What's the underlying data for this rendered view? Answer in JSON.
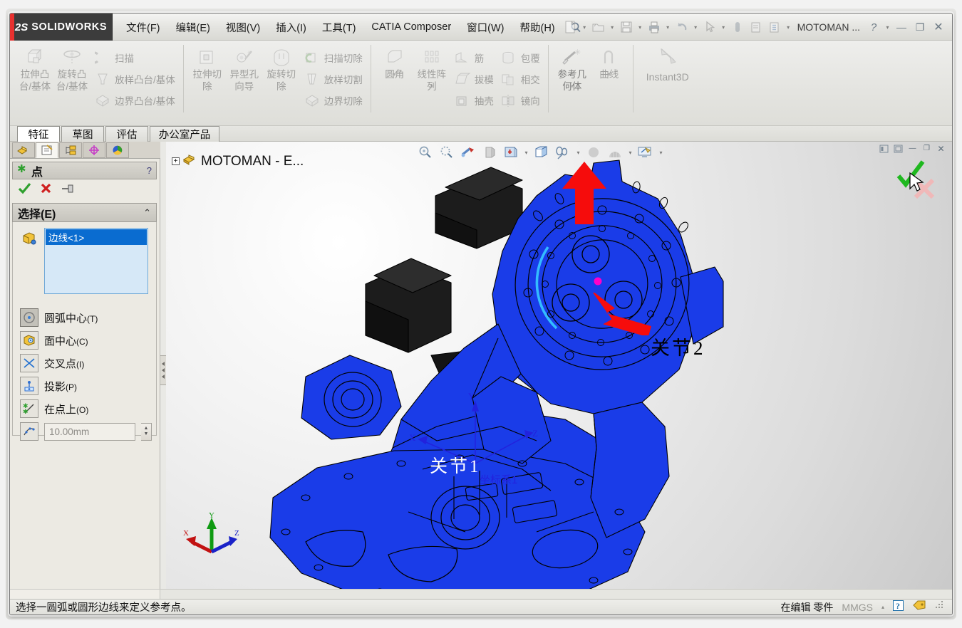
{
  "window": {
    "brand": "SOLIDWORKS",
    "brand_mark": "2S",
    "document_name": "MOTOMAN ...",
    "help_glyph": "?",
    "minimize_glyph": "—",
    "restore_glyph": "❐",
    "close_glyph": "✕"
  },
  "menus": [
    {
      "label": "文件(F)",
      "name": "menu-file"
    },
    {
      "label": "编辑(E)",
      "name": "menu-edit"
    },
    {
      "label": "视图(V)",
      "name": "menu-view"
    },
    {
      "label": "插入(I)",
      "name": "menu-insert"
    },
    {
      "label": "工具(T)",
      "name": "menu-tools"
    },
    {
      "label": "CATIA Composer",
      "name": "menu-catia-composer"
    },
    {
      "label": "窗口(W)",
      "name": "menu-window"
    },
    {
      "label": "帮助(H)",
      "name": "menu-help"
    }
  ],
  "quick_access": [
    {
      "icon": "new-document-icon",
      "has_caret": true
    },
    {
      "icon": "open-folder-icon",
      "has_caret": true
    },
    {
      "icon": "save-icon",
      "has_caret": true
    },
    {
      "icon": "print-icon",
      "has_caret": true
    },
    {
      "icon": "undo-icon",
      "has_caret": true
    },
    {
      "icon": "select-cursor-icon",
      "has_caret": true
    },
    {
      "icon": "rebuild-icon",
      "has_caret": false
    },
    {
      "icon": "file-properties-icon",
      "has_caret": false
    },
    {
      "icon": "options-icon",
      "has_caret": true
    }
  ],
  "ribbon": {
    "groups": [
      {
        "name": "boss-base-group",
        "big": [
          {
            "label": "拉伸凸台/基体",
            "icon": "extrude-boss-icon"
          },
          {
            "label": "旋转凸台/基体",
            "icon": "revolve-boss-icon"
          }
        ],
        "small": [
          {
            "label": "扫描",
            "icon": "sweep-icon"
          },
          {
            "label": "放样凸台/基体",
            "icon": "loft-boss-icon"
          },
          {
            "label": "边界凸台/基体",
            "icon": "boundary-boss-icon"
          }
        ]
      },
      {
        "name": "cut-group",
        "big": [
          {
            "label": "拉伸切除",
            "icon": "extrude-cut-icon"
          },
          {
            "label": "异型孔向导",
            "icon": "hole-wizard-icon"
          },
          {
            "label": "旋转切除",
            "icon": "revolve-cut-icon"
          }
        ],
        "small": [
          {
            "label": "扫描切除",
            "icon": "sweep-cut-icon"
          },
          {
            "label": "放样切割",
            "icon": "loft-cut-icon"
          },
          {
            "label": "边界切除",
            "icon": "boundary-cut-icon"
          }
        ]
      },
      {
        "name": "features-group",
        "big": [
          {
            "label": "圆角",
            "icon": "fillet-icon",
            "caret": true
          },
          {
            "label": "线性阵列",
            "icon": "linear-pattern-icon",
            "caret": true
          }
        ],
        "small": [
          {
            "label": "筋",
            "icon": "rib-icon"
          },
          {
            "label": "拔模",
            "icon": "draft-icon"
          },
          {
            "label": "抽壳",
            "icon": "shell-icon"
          }
        ],
        "small2": [
          {
            "label": "包覆",
            "icon": "wrap-icon"
          },
          {
            "label": "相交",
            "icon": "intersect-icon"
          },
          {
            "label": "镜向",
            "icon": "mirror-icon"
          }
        ]
      },
      {
        "name": "reference-group",
        "big": [
          {
            "label": "参考几何体",
            "icon": "reference-geometry-icon",
            "caret": true
          },
          {
            "label": "曲线",
            "icon": "curves-icon",
            "caret": true
          }
        ]
      }
    ],
    "instant3d": {
      "label": "Instant3D",
      "icon": "instant3d-icon"
    }
  },
  "command_tabs": [
    {
      "label": "特征",
      "active": true
    },
    {
      "label": "草图",
      "active": false
    },
    {
      "label": "评估",
      "active": false
    },
    {
      "label": "办公室产品",
      "active": false
    }
  ],
  "manager_tabs": [
    {
      "name": "feature-manager-tab",
      "icon": "feature-tree-icon",
      "active": false
    },
    {
      "name": "property-manager-tab",
      "icon": "property-manager-icon",
      "active": true
    },
    {
      "name": "configuration-manager-tab",
      "icon": "configuration-icon",
      "active": false
    },
    {
      "name": "dimxpert-manager-tab",
      "icon": "dimxpert-icon",
      "active": false
    },
    {
      "name": "display-manager-tab",
      "icon": "appearance-sphere-icon",
      "active": false
    }
  ],
  "property_manager": {
    "title": "点",
    "title_icon": "point-asterisk-icon",
    "help_glyph": "?",
    "actions": [
      {
        "name": "ok-button",
        "icon": "green-check-icon"
      },
      {
        "name": "cancel-button",
        "icon": "red-x-icon"
      },
      {
        "name": "pin-button",
        "icon": "pin-icon"
      }
    ],
    "selection_section": {
      "title": "选择(E)",
      "collapse_glyph": "⌃",
      "selection_icon": "edge-selection-icon",
      "items": [
        "边线<1>"
      ]
    },
    "options": [
      {
        "label": "圆弧中心",
        "mnemonic": "(T)",
        "icon": "arc-center-icon",
        "selected": true
      },
      {
        "label": "面中心",
        "mnemonic": "(C)",
        "icon": "face-center-icon",
        "selected": false
      },
      {
        "label": "交叉点",
        "mnemonic": "(I)",
        "icon": "intersection-icon",
        "selected": false
      },
      {
        "label": "投影",
        "mnemonic": "(P)",
        "icon": "projection-icon",
        "selected": false
      },
      {
        "label": "在点上",
        "mnemonic": "(O)",
        "icon": "on-point-icon",
        "selected": false
      }
    ],
    "distance_field": {
      "icon": "along-curve-distance-icon",
      "value": "10.00mm",
      "placeholder": "10.00mm"
    }
  },
  "viewport": {
    "toolbar": [
      {
        "name": "previous-view-button",
        "icon": "zoom-previous-icon",
        "caret": false
      },
      {
        "name": "zoom-to-area-button",
        "icon": "zoom-to-area-icon",
        "caret": false
      },
      {
        "name": "section-view-button",
        "icon": "section-view-icon",
        "caret": false
      },
      {
        "name": "view-orientation-button",
        "icon": "view-orientation-icon",
        "caret": false
      },
      {
        "name": "display-style-button",
        "icon": "display-style-icon",
        "caret": true
      },
      {
        "name": "hide-show-items-button",
        "icon": "hide-show-cube-icon",
        "caret": false
      },
      {
        "name": "edit-appearance-button",
        "icon": "appearance-icon",
        "caret": true
      },
      {
        "name": "apply-scene-button",
        "icon": "scene-sphere-icon",
        "caret": false
      },
      {
        "name": "view-settings-button",
        "icon": "view-settings-icon",
        "caret": true
      },
      {
        "name": "display-pane-button",
        "icon": "display-pane-icon",
        "caret": true
      }
    ],
    "window_controls": [
      {
        "name": "tile-left-button",
        "glyph": "◫"
      },
      {
        "name": "tile-right-button",
        "glyph": "◫"
      },
      {
        "name": "doc-minimize-button",
        "glyph": "—"
      },
      {
        "name": "doc-restore-button",
        "glyph": "❐"
      },
      {
        "name": "doc-close-button",
        "glyph": "✕"
      }
    ],
    "tree_root": {
      "label": "MOTOMAN - E...",
      "expand_glyph": "+",
      "icon": "part-document-icon"
    },
    "confirm_corner": {
      "ok_icon": "green-check-icon",
      "cancel_icon": "pink-x-icon"
    },
    "annotations": [
      {
        "text": "关节2",
        "name": "annotation-joint-2",
        "color": "#000000"
      },
      {
        "text": "关节1",
        "name": "annotation-joint-1",
        "color": "#ffffff"
      },
      {
        "text": "坐标系1",
        "name": "annotation-coordinate-system",
        "color": "#2222dd"
      }
    ],
    "triad_labels": {
      "x": "X",
      "y": "Y",
      "z": "Z"
    },
    "origin_labels": {
      "x": "X",
      "y": "Y",
      "z": "Z"
    },
    "model_color": "#1a3ce8",
    "motor_color": "#1a1a1a",
    "selected_point_color": "#ff00c8",
    "highlight_edge_color": "#33bbff"
  },
  "status_bar": {
    "message": "选择一圆弧或圆形边线来定义参考点。",
    "editing": "在编辑 零件",
    "units": "MMGS",
    "units_caret": "▴",
    "help_glyph": "?",
    "tag_icon": "tag-icon"
  }
}
